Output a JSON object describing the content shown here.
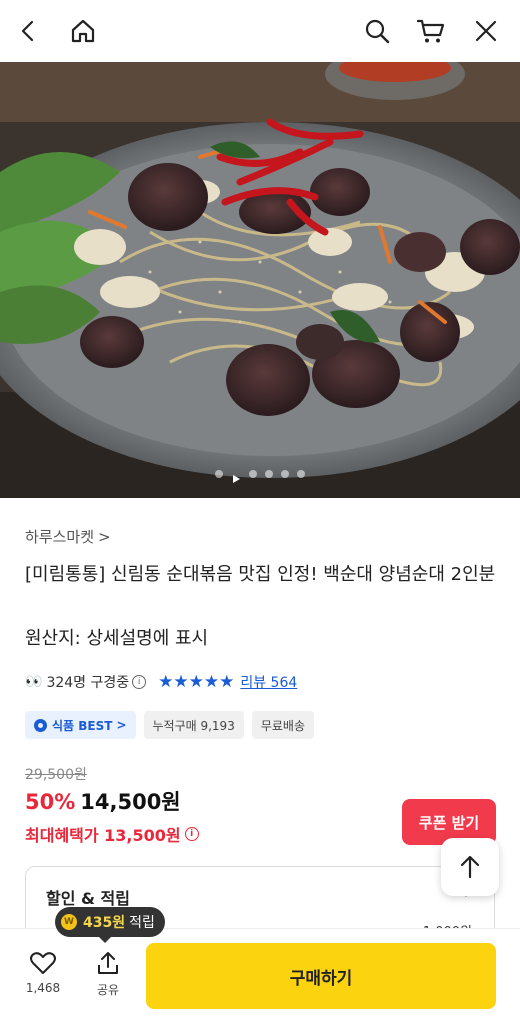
{
  "header": {
    "back_icon": "chevron-left-icon",
    "home_icon": "home-icon",
    "search_icon": "search-icon",
    "cart_icon": "cart-icon",
    "close_icon": "close-icon"
  },
  "gallery": {
    "image_alt": "순대볶음 product photo",
    "indicator_count": 6
  },
  "product": {
    "seller": "하루스마켓",
    "seller_chevron": ">",
    "title": "[미림통통] 신림동 순대볶음 맛집 인정! 백순대 양념순대 2인분",
    "origin": "원산지: 상세설명에 표시",
    "viewers": "324명 구경중",
    "stars": "★★★★★",
    "review_label": "리뷰 564",
    "tags": {
      "best": "식품 BEST",
      "best_chevron": ">",
      "cumulative": "누적구매 9,193",
      "shipping": "무료배송"
    },
    "original_price": "29,500원",
    "discount_rate": "50%",
    "price": "14,500원",
    "best_benefit_price": "최대혜택가 13,500원"
  },
  "coupon_button": "쿠폰 받기",
  "discount_section": {
    "label": "할인 & 적립",
    "partial_value": "1,000원"
  },
  "reward_tooltip": {
    "coin": "W",
    "amount": "435원",
    "suffix": "적립"
  },
  "bottom_bar": {
    "like_count": "1,468",
    "share_label": "공유",
    "buy_label": "구매하기"
  },
  "colors": {
    "accent_red": "#e8283a",
    "buy_yellow": "#fbd30f",
    "link_blue": "#1a5bd6"
  }
}
